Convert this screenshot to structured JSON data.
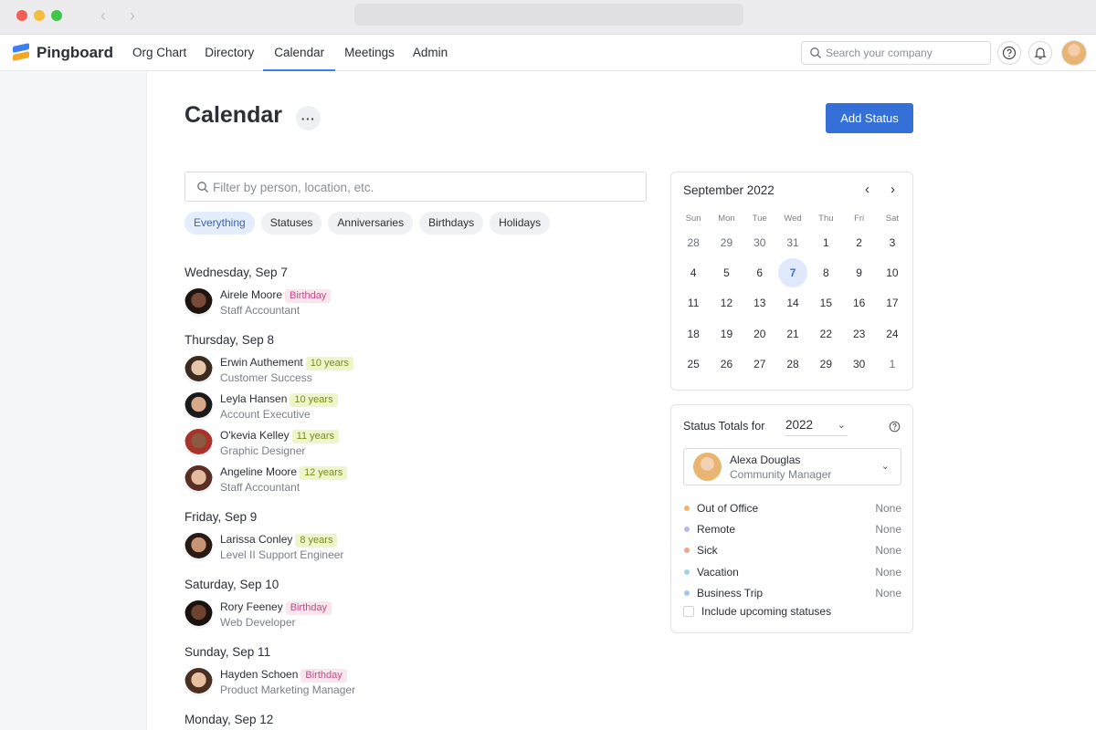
{
  "app": {
    "brand": "Pingboard",
    "nav": [
      "Org Chart",
      "Directory",
      "Calendar",
      "Meetings",
      "Admin"
    ],
    "active_nav": "Calendar",
    "search_placeholder": "Search your company"
  },
  "page": {
    "title": "Calendar",
    "more_label": "···",
    "add_status_label": "Add Status",
    "filter_placeholder": "Filter by person, location, etc.",
    "chips": [
      "Everything",
      "Statuses",
      "Anniversaries",
      "Birthdays",
      "Holidays"
    ],
    "active_chip": "Everything"
  },
  "events": [
    {
      "day": "Wednesday, Sep 7",
      "people": [
        {
          "name": "Airele Moore",
          "badge": "Birthday",
          "badge_type": "bday",
          "title": "Staff Accountant",
          "skin": "#7a4a35",
          "hair": "#1e1410"
        }
      ]
    },
    {
      "day": "Thursday, Sep 8",
      "people": [
        {
          "name": "Erwin Authement",
          "badge": "10 years",
          "badge_type": "years",
          "title": "Customer Success",
          "skin": "#e8c4a8",
          "hair": "#3a2a20"
        },
        {
          "name": "Leyla Hansen",
          "badge": "10 years",
          "badge_type": "years",
          "title": "Account Executive",
          "skin": "#d9a888",
          "hair": "#1a1a1a"
        },
        {
          "name": "O'kevia Kelley",
          "badge": "11 years",
          "badge_type": "years",
          "title": "Graphic Designer",
          "skin": "#8a5a42",
          "hair": "#a8332a"
        },
        {
          "name": "Angeline Moore",
          "badge": "12 years",
          "badge_type": "years",
          "title": "Staff Accountant",
          "skin": "#e5bba0",
          "hair": "#5a2e22"
        }
      ]
    },
    {
      "day": "Friday, Sep 9",
      "people": [
        {
          "name": "Larissa Conley",
          "badge": "8 years",
          "badge_type": "years",
          "title": "Level II Support Engineer",
          "skin": "#c99474",
          "hair": "#2a1a14"
        }
      ]
    },
    {
      "day": "Saturday, Sep 10",
      "people": [
        {
          "name": "Rory Feeney",
          "badge": "Birthday",
          "badge_type": "bday",
          "title": "Web Developer",
          "skin": "#6e4330",
          "hair": "#1a120e"
        }
      ]
    },
    {
      "day": "Sunday, Sep 11",
      "people": [
        {
          "name": "Hayden Schoen",
          "badge": "Birthday",
          "badge_type": "bday",
          "title": "Product Marketing Manager",
          "skin": "#e8c0a0",
          "hair": "#4a3022"
        }
      ]
    },
    {
      "day": "Monday, Sep 12",
      "people": []
    }
  ],
  "calendar": {
    "month": "September 2022",
    "dow": [
      "Sun",
      "Mon",
      "Tue",
      "Wed",
      "Thu",
      "Fri",
      "Sat"
    ],
    "weeks": [
      [
        "28",
        "29",
        "30",
        "31",
        "1",
        "2",
        "3"
      ],
      [
        "4",
        "5",
        "6",
        "7",
        "8",
        "9",
        "10"
      ],
      [
        "11",
        "12",
        "13",
        "14",
        "15",
        "16",
        "17"
      ],
      [
        "18",
        "19",
        "20",
        "21",
        "22",
        "23",
        "24"
      ],
      [
        "25",
        "26",
        "27",
        "28",
        "29",
        "30",
        "1"
      ]
    ],
    "selected": "7"
  },
  "status_totals": {
    "label": "Status Totals for",
    "year": "2022",
    "person": {
      "name": "Alexa Douglas",
      "title": "Community Manager"
    },
    "rows": [
      {
        "label": "Out of Office",
        "value": "None",
        "color": "#f2b36b"
      },
      {
        "label": "Remote",
        "value": "None",
        "color": "#b9b6ef"
      },
      {
        "label": "Sick",
        "value": "None",
        "color": "#f1a58a"
      },
      {
        "label": "Vacation",
        "value": "None",
        "color": "#9fd3ea"
      },
      {
        "label": "Business Trip",
        "value": "None",
        "color": "#a9c4ee"
      }
    ],
    "include_upcoming": "Include upcoming statuses"
  },
  "colors": {
    "accent": "#3570d8",
    "birthday_badge": "#fbe6f0",
    "years_badge": "#eef6c9"
  }
}
